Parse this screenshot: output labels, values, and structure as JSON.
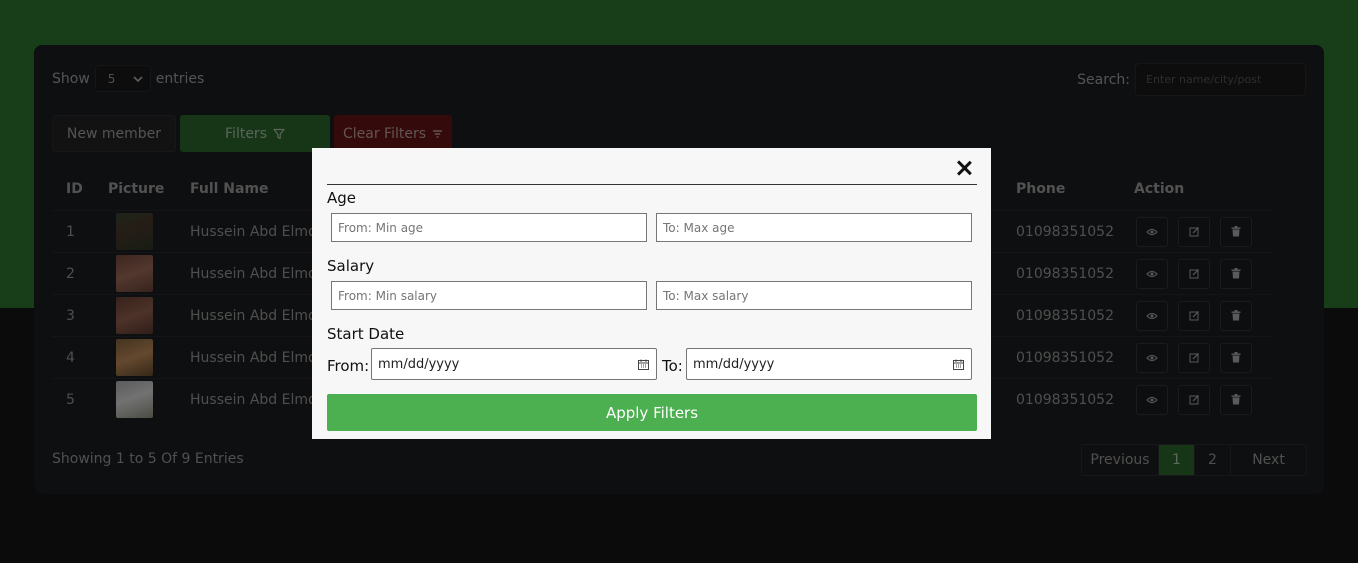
{
  "colors": {
    "top_background": "#2e7d32",
    "accent_green": "#4caf50",
    "danger": "#8b1a1a"
  },
  "toolbar": {
    "show_label": "Show",
    "entries_select": "5",
    "entries_label": "entries",
    "search_label": "Search:",
    "search_placeholder": "Enter name/city/post",
    "new_member": "New member",
    "filters": "Filters",
    "clear_filters": "Clear Filters"
  },
  "table": {
    "headers": {
      "id": "ID",
      "picture": "Picture",
      "full_name": "Full Name",
      "phone": "Phone",
      "action": "Action"
    },
    "rows": [
      {
        "id": "1",
        "name": "Hussein Abd Elmon",
        "phone": "01098351052"
      },
      {
        "id": "2",
        "name": "Hussein Abd Elmon",
        "phone": "01098351052"
      },
      {
        "id": "3",
        "name": "Hussein Abd Elmon",
        "phone": "01098351052"
      },
      {
        "id": "4",
        "name": "Hussein Abd Elmon",
        "phone": "01098351052"
      },
      {
        "id": "5",
        "name": "Hussein Abd Elmon",
        "phone": "01098351052"
      }
    ]
  },
  "footer": {
    "info": "Showing 1 to 5 Of 9 Entries",
    "pagination": {
      "previous": "Previous",
      "page1": "1",
      "page2": "2",
      "next": "Next"
    }
  },
  "modal": {
    "age_label": "Age",
    "age_min_placeholder": "From: Min age",
    "age_max_placeholder": "To: Max age",
    "salary_label": "Salary",
    "salary_min_placeholder": "From: Min salary",
    "salary_max_placeholder": "To: Max salary",
    "start_date_label": "Start Date",
    "from_label": "From:",
    "to_label": "To:",
    "date_placeholder": "mm/dd/yyyy",
    "apply_button": "Apply Filters"
  }
}
